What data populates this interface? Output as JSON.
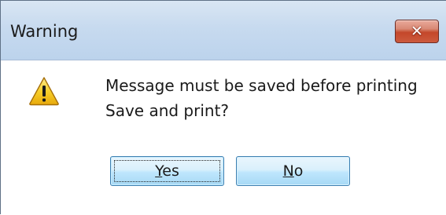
{
  "dialog": {
    "title": "Warning",
    "close_glyph": "✕",
    "icon": "warning-triangle-icon",
    "message_line1": "Message must be saved before printing",
    "message_line2": "Save and print?",
    "buttons": {
      "yes": {
        "mnemonic": "Y",
        "rest": "es"
      },
      "no": {
        "mnemonic": "N",
        "rest": "o"
      }
    }
  },
  "colors": {
    "titlebar": "#c7daef",
    "close_button": "#c4472a",
    "button_border": "#3c7fb1",
    "warning_yellow": "#f4c21a"
  }
}
